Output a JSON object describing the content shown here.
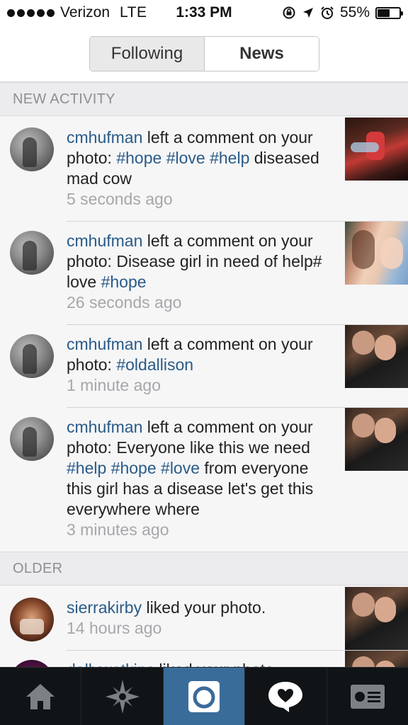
{
  "status_bar": {
    "carrier": "Verizon",
    "network": "LTE",
    "time": "1:33 PM",
    "battery": "55%",
    "battery_level": 0.55
  },
  "header": {
    "tabs": [
      {
        "label": "Following",
        "selected": false
      },
      {
        "label": "News",
        "selected": true
      }
    ]
  },
  "sections": {
    "new": "NEW ACTIVITY",
    "older": "OLDER"
  },
  "activities": [
    {
      "user": "cmhufman",
      "action": " left a comment on your photo: ",
      "parts": [
        "#hope",
        " ",
        "#love",
        " ",
        "#help",
        " diseased mad cow"
      ],
      "time": "5 seconds ago"
    },
    {
      "user": "cmhufman",
      "action": " left a comment on your photo: Disease girl in need of help# love ",
      "parts": [
        "#hope"
      ],
      "time": "26 seconds ago"
    },
    {
      "user": "cmhufman",
      "action": " left a comment on your photo: ",
      "parts": [
        "#oldallison"
      ],
      "time": "1 minute ago"
    },
    {
      "user": "cmhufman",
      "action": " left a comment on your photo: Everyone like this we need ",
      "parts": [
        "#help",
        " ",
        "#hope",
        " ",
        "#love",
        " from everyone this girl has a disease let's get this everywhere where"
      ],
      "time": "3 minutes ago"
    },
    {
      "user": "sierrakirby",
      "action": " liked your photo.",
      "parts": [],
      "time": "14 hours ago"
    },
    {
      "user": "dollywatkins",
      "action": " liked your photo.",
      "parts": [],
      "time": ""
    }
  ],
  "tab_bar": {
    "tabs": [
      "home-icon",
      "explore-icon",
      "camera-icon",
      "activity-icon",
      "profile-icon"
    ],
    "active": "activity-icon"
  },
  "colors": {
    "link": "#2a5b87",
    "timestamp": "#a7a7ab",
    "tab_bar": "#111416",
    "camera_tab": "#3a6c9a"
  }
}
